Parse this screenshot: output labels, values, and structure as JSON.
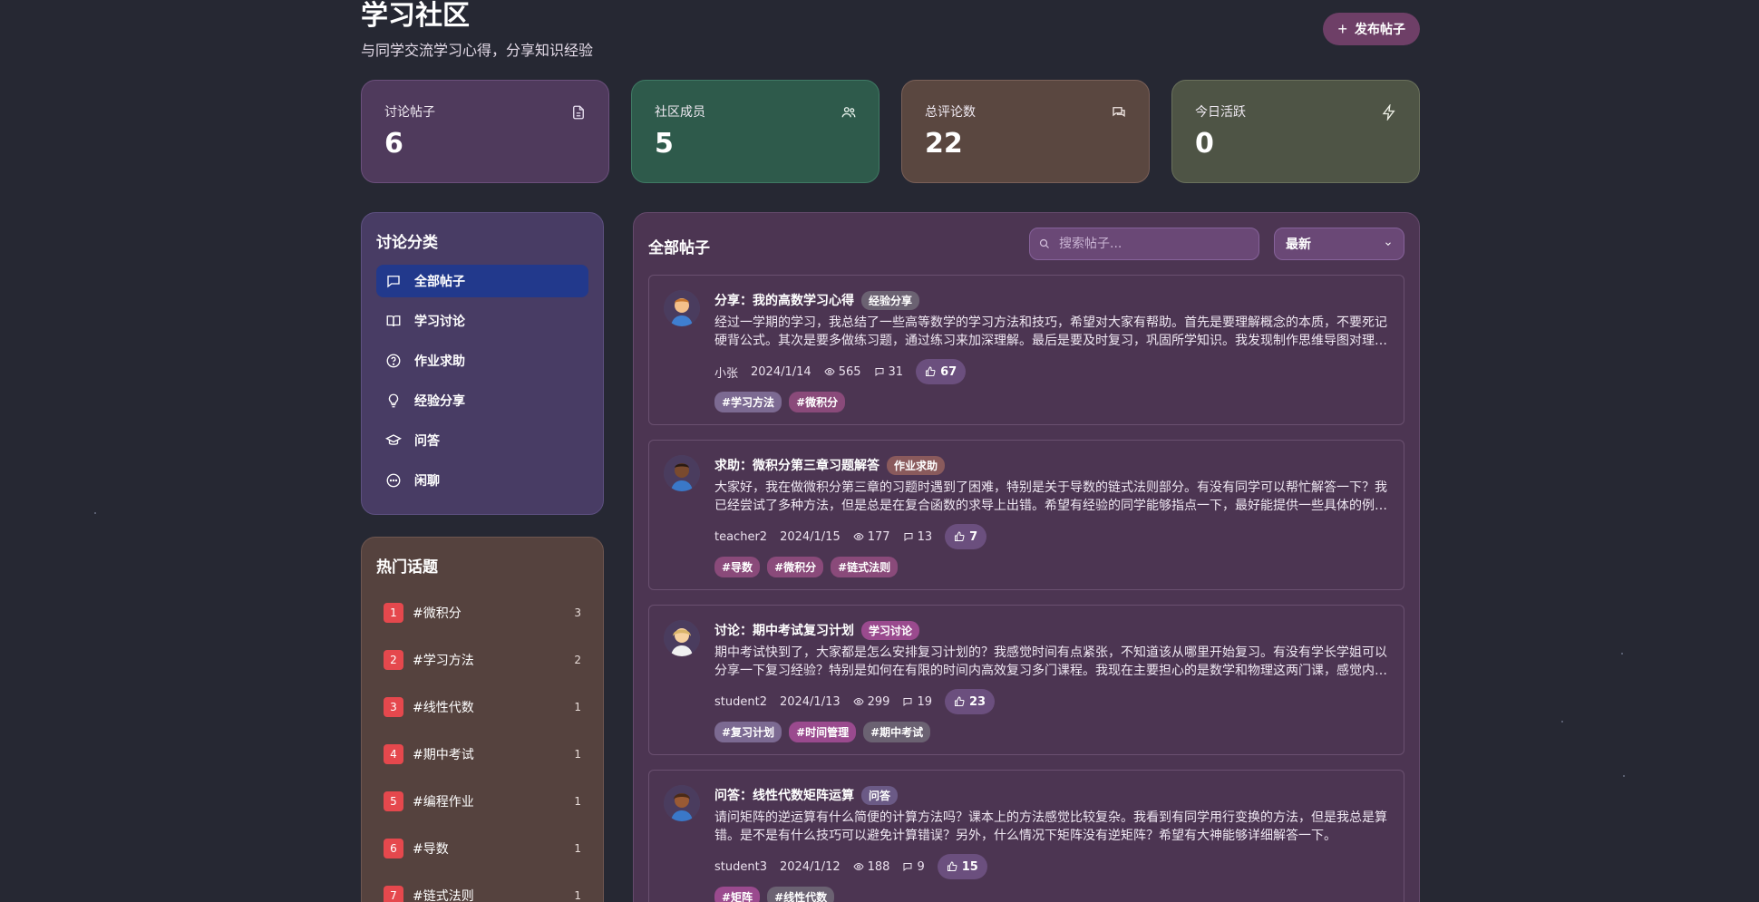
{
  "header": {
    "title": "学习社区",
    "subtitle": "与同学交流学习心得，分享知识经验",
    "new_post_label": "发布帖子"
  },
  "stats": [
    {
      "label": "讨论帖子",
      "value": "6",
      "icon": "document-icon",
      "color": "#4f3a5c"
    },
    {
      "label": "社区成员",
      "value": "5",
      "icon": "users-icon",
      "color": "#2e5a4b"
    },
    {
      "label": "总评论数",
      "value": "22",
      "icon": "comments-icon",
      "color": "#5a4740"
    },
    {
      "label": "今日活跃",
      "value": "0",
      "icon": "lightning-icon",
      "color": "#4e5445"
    }
  ],
  "categories": {
    "title": "讨论分类",
    "items": [
      {
        "label": "全部帖子",
        "icon": "chat-bubble-icon",
        "active": true
      },
      {
        "label": "学习讨论",
        "icon": "book-icon"
      },
      {
        "label": "作业求助",
        "icon": "help-circle-icon"
      },
      {
        "label": "经验分享",
        "icon": "lightbulb-icon"
      },
      {
        "label": "问答",
        "icon": "graduation-cap-icon"
      },
      {
        "label": "闲聊",
        "icon": "chat-dots-icon"
      }
    ]
  },
  "hot_topics": {
    "title": "热门话题",
    "items": [
      {
        "rank": "1",
        "name": "#微积分",
        "count": "3"
      },
      {
        "rank": "2",
        "name": "#学习方法",
        "count": "2"
      },
      {
        "rank": "3",
        "name": "#线性代数",
        "count": "1"
      },
      {
        "rank": "4",
        "name": "#期中考试",
        "count": "1"
      },
      {
        "rank": "5",
        "name": "#编程作业",
        "count": "1"
      },
      {
        "rank": "6",
        "name": "#导数",
        "count": "1"
      },
      {
        "rank": "7",
        "name": "#链式法则",
        "count": "1"
      }
    ]
  },
  "main": {
    "title": "全部帖子",
    "search_placeholder": "搜索帖子...",
    "sort_value": "最新"
  },
  "posts": [
    {
      "title": "分享：我的高数学习心得",
      "category": "经验分享",
      "category_color": "#6b6272",
      "body": "经过一学期的学习，我总结了一些高等数学的学习方法和技巧，希望对大家有帮助。首先是要理解概念的本质，不要死记硬背公式。其次是要多做练习题，通过练习来加深理解。最后是要及时复习，巩固所学知识。我发现制作思维导图对理解知识结构很有帮助。",
      "author": "小张",
      "date": "2024/1/14",
      "views": "565",
      "comments": "31",
      "likes": "67",
      "tags": [
        {
          "label": "#学习方法",
          "color": "#7c6a92"
        },
        {
          "label": "#微积分",
          "color": "#8a4a7a"
        }
      ]
    },
    {
      "title": "求助：微积分第三章习题解答",
      "category": "作业求助",
      "category_color": "#8a5a5c",
      "body": "大家好，我在做微积分第三章的习题时遇到了困难，特别是关于导数的链式法则部分。有没有同学可以帮忙解答一下？我已经尝试了多种方法，但是总是在复合函数的求导上出错。希望有经验的同学能够指点一下，最好能提供一些具体的例题。",
      "author": "teacher2",
      "date": "2024/1/15",
      "views": "177",
      "comments": "13",
      "likes": "7",
      "tags": [
        {
          "label": "#导数",
          "color": "#8a4a7a"
        },
        {
          "label": "#微积分",
          "color": "#8a4a7a"
        },
        {
          "label": "#链式法则",
          "color": "#8a4a7a"
        }
      ]
    },
    {
      "title": "讨论：期中考试复习计划",
      "category": "学习讨论",
      "category_color": "#9a4a8e",
      "body": "期中考试快到了，大家都是怎么安排复习计划的？我感觉时间有点紧张，不知道该从哪里开始复习。有没有学长学姐可以分享一下复习经验？特别是如何在有限的时间内高效复习多门课程。我现在主要担心的是数学和物理这两门课，感觉内容很多。",
      "author": "student2",
      "date": "2024/1/13",
      "views": "299",
      "comments": "19",
      "likes": "23",
      "tags": [
        {
          "label": "#复习计划",
          "color": "#7c6a92"
        },
        {
          "label": "#时间管理",
          "color": "#9a4a8e"
        },
        {
          "label": "#期中考试",
          "color": "#6b6272"
        }
      ]
    },
    {
      "title": "问答：线性代数矩阵运算",
      "category": "问答",
      "category_color": "#6b5a86",
      "body": "请问矩阵的逆运算有什么简便的计算方法吗？课本上的方法感觉比较复杂。我看到有同学用行变换的方法，但是我总是算错。是不是有什么技巧可以避免计算错误？另外，什么情况下矩阵没有逆矩阵？希望有大神能够详细解答一下。",
      "author": "student3",
      "date": "2024/1/12",
      "views": "188",
      "comments": "9",
      "likes": "15",
      "tags": [
        {
          "label": "#矩阵",
          "color": "#9a4a8e"
        },
        {
          "label": "#线性代数",
          "color": "#6b6272"
        }
      ]
    }
  ]
}
